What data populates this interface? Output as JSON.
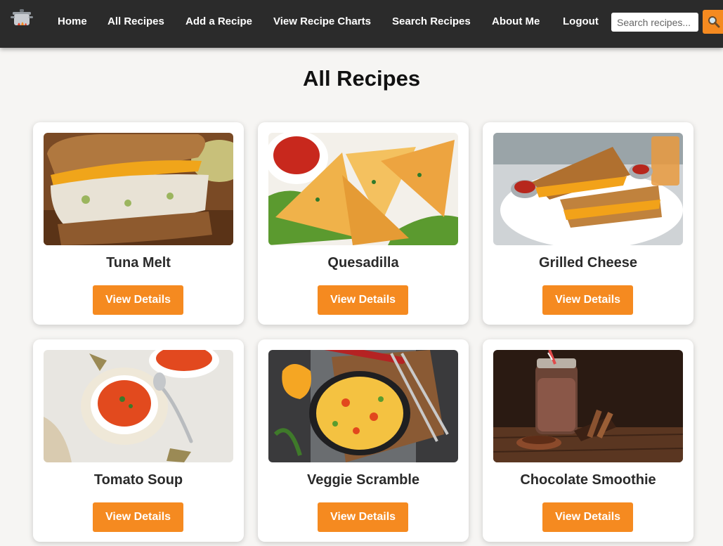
{
  "nav": {
    "links": [
      "Home",
      "All Recipes",
      "Add a Recipe",
      "View Recipe Charts",
      "Search Recipes",
      "About Me",
      "Logout"
    ],
    "search_placeholder": "Search recipes..."
  },
  "page": {
    "title": "All Recipes"
  },
  "colors": {
    "navbar": "#2b2b2b",
    "accent": "#f58a20",
    "page_bg": "#f6f5f3"
  },
  "recipes": [
    {
      "name": "Tuna Melt",
      "button": "View Details",
      "image": "tuna-melt-photo"
    },
    {
      "name": "Quesadilla",
      "button": "View Details",
      "image": "quesadilla-photo"
    },
    {
      "name": "Grilled Cheese",
      "button": "View Details",
      "image": "grilled-cheese-photo"
    },
    {
      "name": "Tomato Soup",
      "button": "View Details",
      "image": "tomato-soup-photo"
    },
    {
      "name": "Veggie Scramble",
      "button": "View Details",
      "image": "veggie-scramble-photo"
    },
    {
      "name": "Chocolate Smoothie",
      "button": "View Details",
      "image": "chocolate-smoothie-photo"
    }
  ]
}
